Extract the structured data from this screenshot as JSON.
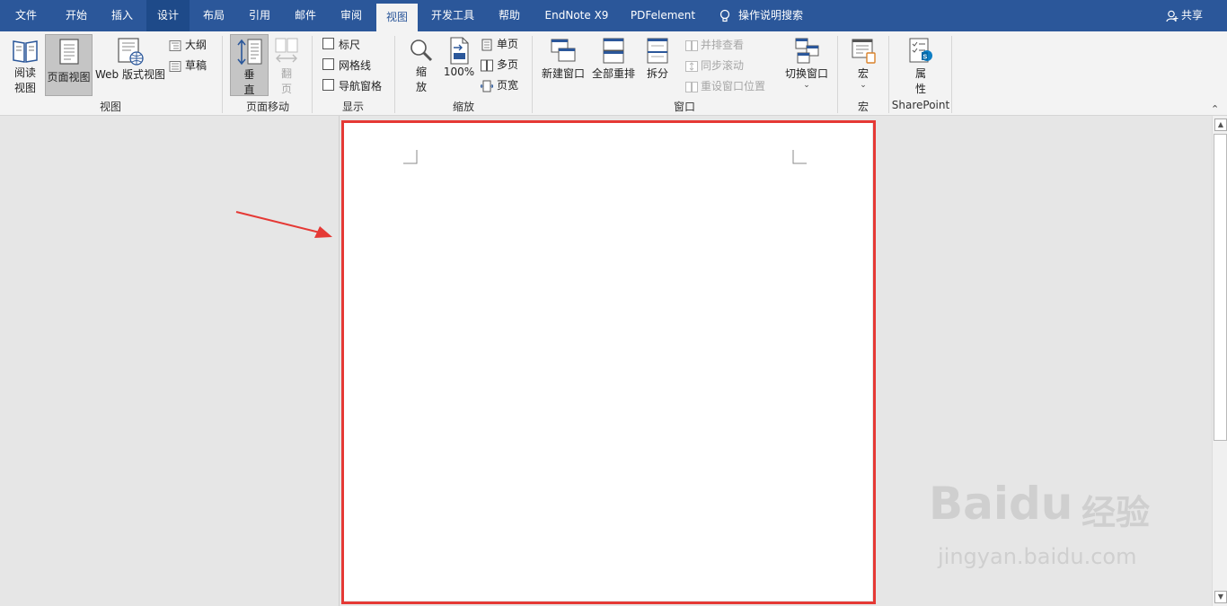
{
  "tabs": [
    "文件",
    "开始",
    "插入",
    "设计",
    "布局",
    "引用",
    "邮件",
    "审阅",
    "视图",
    "开发工具",
    "帮助",
    "EndNote X9",
    "PDFelement"
  ],
  "tell_me": "操作说明搜索",
  "share": "共享",
  "ribbon": {
    "views": {
      "read_line1": "阅读",
      "read_line2": "视图",
      "print_layout": "页面视图",
      "web_layout": "Web 版式视图",
      "outline": "大纲",
      "draft": "草稿",
      "group": "视图"
    },
    "page_movement": {
      "vertical_line1": "垂",
      "vertical_line2": "直",
      "side_line1": "翻",
      "side_line2": "页",
      "group": "页面移动"
    },
    "show": {
      "ruler": "标尺",
      "gridlines": "网格线",
      "nav_pane": "导航窗格",
      "group": "显示"
    },
    "zoom": {
      "zoom_line1": "缩",
      "zoom_line2": "放",
      "hundred": "100%",
      "one_page": "单页",
      "multi_page": "多页",
      "page_width": "页宽",
      "group": "缩放"
    },
    "window": {
      "new_window": "新建窗口",
      "arrange_all": "全部重排",
      "split": "拆分",
      "side_by_side": "并排查看",
      "sync_scroll": "同步滚动",
      "reset_pos": "重设窗口位置",
      "switch_window": "切换窗口",
      "group": "窗口"
    },
    "macros": {
      "label": "宏",
      "group": "宏"
    },
    "sharepoint": {
      "prop_line1": "属",
      "prop_line2": "性",
      "group": "SharePoint"
    }
  },
  "watermark": {
    "brand": "Baidu",
    "brand_cn": "经验",
    "url": "jingyan.baidu.com"
  },
  "colors": {
    "tabbar": "#2b579a",
    "highlight": "#e53935",
    "arrow": "#e53935"
  }
}
